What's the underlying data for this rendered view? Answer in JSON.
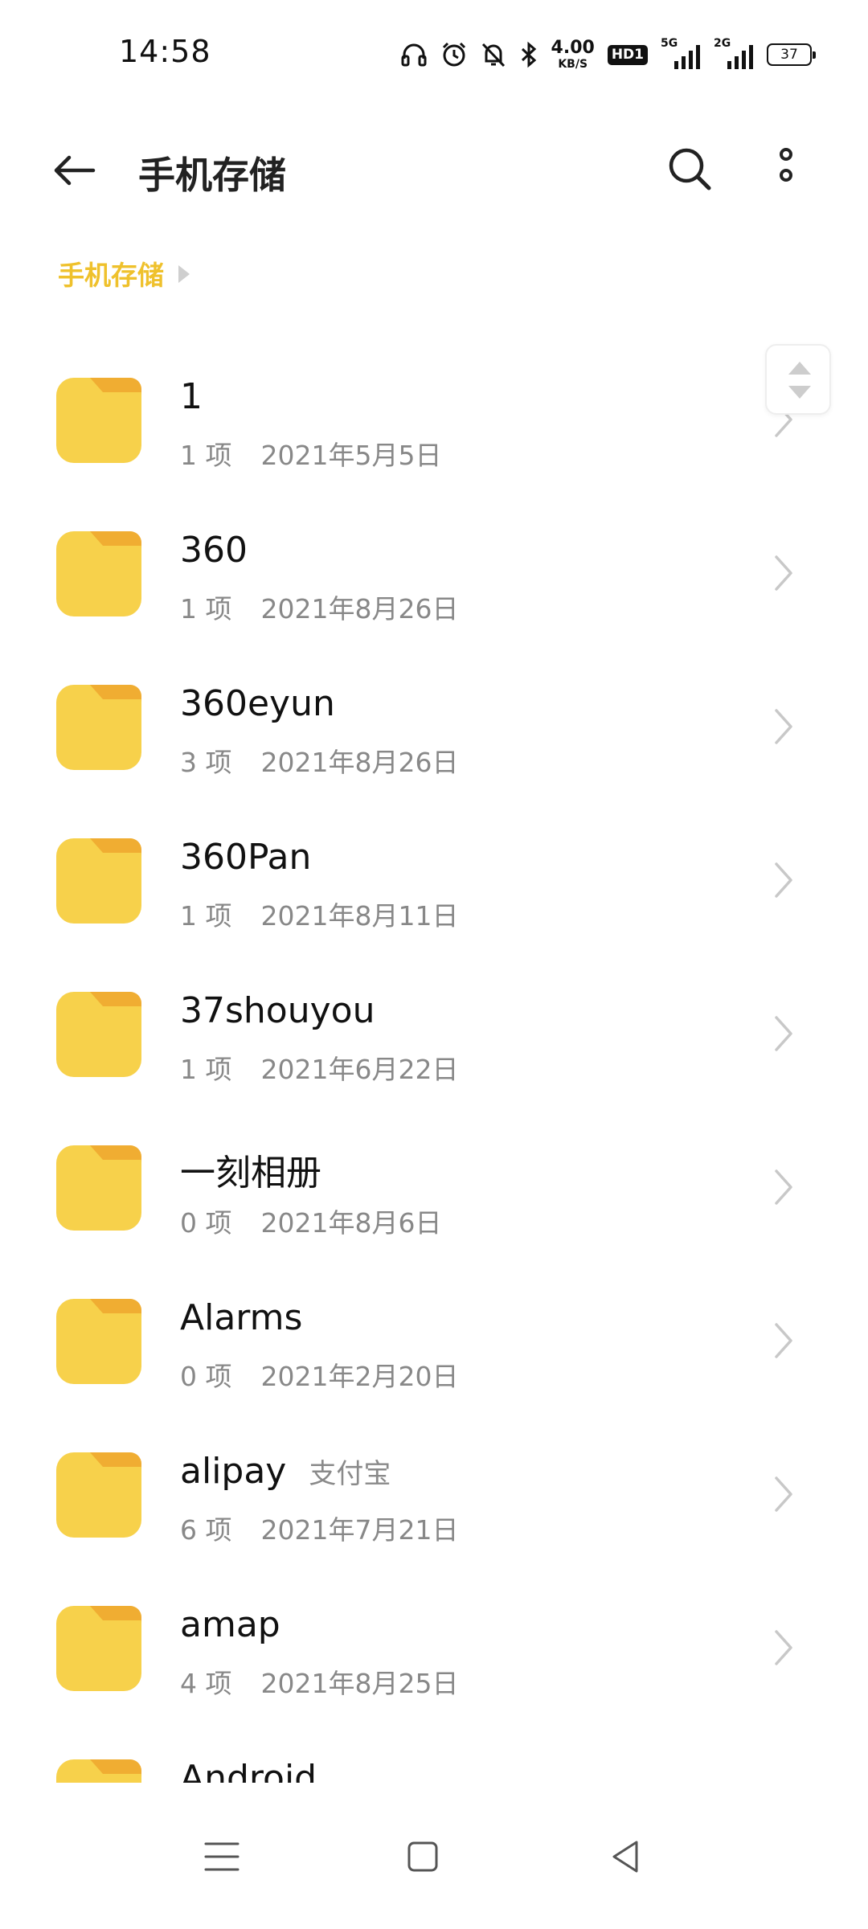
{
  "status_bar": {
    "time": "14:58",
    "speed_value": "4.00",
    "speed_unit": "KB/S",
    "hd_badge": "HD1",
    "sim1_label": "5G",
    "sim2_label": "2G",
    "battery_level": "37",
    "icons": [
      "headset-icon",
      "alarm-icon",
      "bell-off-icon",
      "bluetooth-icon",
      "signal-icon",
      "battery-icon"
    ]
  },
  "header": {
    "title": "手机存储",
    "icons": [
      "back-arrow-icon",
      "search-icon",
      "more-vertical-icon"
    ]
  },
  "breadcrumb": {
    "items": [
      "手机存储"
    ]
  },
  "accent_color": "#efc12c",
  "folder_colors": {
    "body": "#f7d14b",
    "tab": "#f0ad32"
  },
  "files": [
    {
      "name": "1",
      "alias": "",
      "count": "1 项",
      "date": "2021年5月5日"
    },
    {
      "name": "360",
      "alias": "",
      "count": "1 项",
      "date": "2021年8月26日"
    },
    {
      "name": "360eyun",
      "alias": "",
      "count": "3 项",
      "date": "2021年8月26日"
    },
    {
      "name": "360Pan",
      "alias": "",
      "count": "1 项",
      "date": "2021年8月11日"
    },
    {
      "name": "37shouyou",
      "alias": "",
      "count": "1 项",
      "date": "2021年6月22日"
    },
    {
      "name": "一刻相册",
      "alias": "",
      "count": "0 项",
      "date": "2021年8月6日"
    },
    {
      "name": "Alarms",
      "alias": "",
      "count": "0 项",
      "date": "2021年2月20日"
    },
    {
      "name": "alipay",
      "alias": "支付宝",
      "count": "6 项",
      "date": "2021年7月21日"
    },
    {
      "name": "amap",
      "alias": "",
      "count": "4 项",
      "date": "2021年8月25日"
    },
    {
      "name": "Android",
      "alias": "",
      "count": "",
      "date": ""
    }
  ],
  "nav_bar": {
    "icons": [
      "menu-icon",
      "home-square-icon",
      "back-triangle-icon"
    ]
  }
}
